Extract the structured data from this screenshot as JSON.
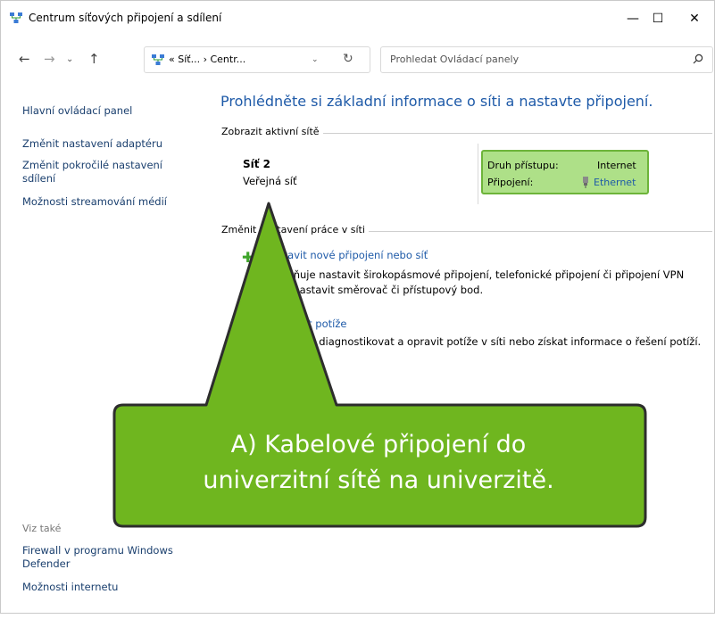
{
  "window": {
    "title": "Centrum síťových připojení a sdílení",
    "controls": {
      "minimize": "—",
      "maximize": "☐",
      "close": "✕"
    }
  },
  "nav": {
    "back": "←",
    "forward": "→",
    "history": "⌄",
    "up": "↑",
    "address": "« Síť... › Centr...",
    "address_dropdown": "⌄",
    "refresh": "↻",
    "search_placeholder": "Prohledat Ovládací panely"
  },
  "sidebar": {
    "items": [
      {
        "label": "Hlavní ovládací panel"
      },
      {
        "label": "Změnit nastavení adaptéru"
      },
      {
        "label": "Změnit pokročilé nastavení sdílení"
      },
      {
        "label": "Možnosti streamování médií"
      }
    ],
    "see_also_title": "Viz také",
    "see_also": [
      {
        "label": "Firewall v programu Windows Defender"
      },
      {
        "label": "Možnosti internetu"
      }
    ]
  },
  "main": {
    "heading": "Prohlédněte si základní informace o síti a nastavte připojení.",
    "active_networks_label": "Zobrazit aktivní sítě",
    "network": {
      "name": "Síť 2",
      "category": "Veřejná síť",
      "access_type_label": "Druh přístupu:",
      "access_type_value": "Internet",
      "connection_label": "Připojení:",
      "connection_value": "Ethernet"
    },
    "change_settings_label": "Změnit nastavení práce v síti",
    "tasks": [
      {
        "link": "Nastavit nové připojení nebo síť",
        "desc_line1": "Umožňuje nastavit širokopásmové připojení, telefonické připojení či připojení VPN",
        "desc_line2": "nebo nastavit směrovač či přístupový bod."
      },
      {
        "link": "Odstranit potíže",
        "desc_line1": "Umožňuje diagnostikovat a opravit potíže v síti nebo získat informace o řešení potíží."
      }
    ]
  },
  "callout": {
    "line1": "A) Kabelové připojení do",
    "line2": "univerzitní sítě na univerzitě.",
    "fill": "#6fb61f",
    "border": "#2d2d2d"
  }
}
